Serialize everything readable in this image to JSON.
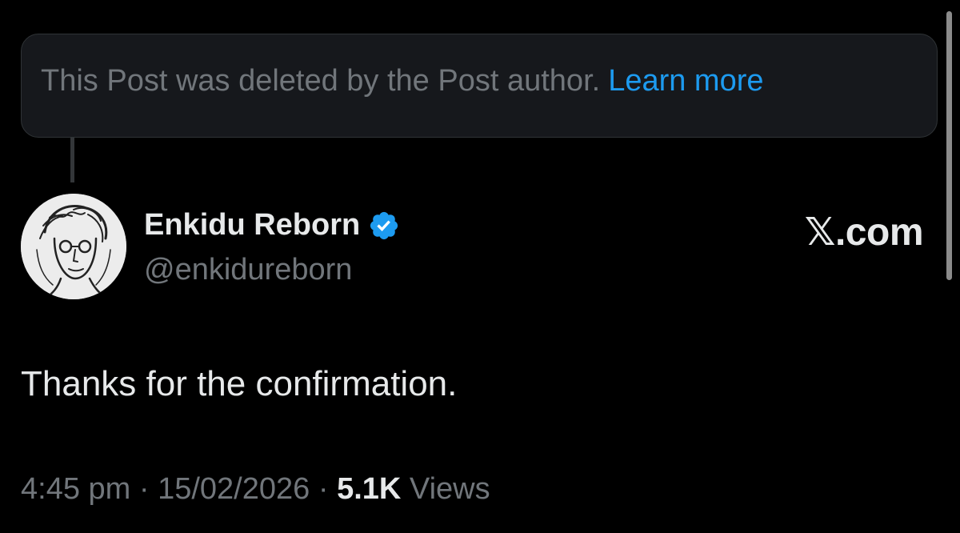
{
  "deleted_notice": {
    "text": "This Post was deleted by the Post author.",
    "link_label": "Learn more"
  },
  "author": {
    "display_name": "Enkidu Reborn",
    "handle": "@enkidureborn",
    "verified_icon": "verified-badge-icon",
    "avatar_icon": "sketched-portrait-avatar"
  },
  "brand": {
    "label": "𝕏.com"
  },
  "post": {
    "text": "Thanks for the confirmation."
  },
  "meta": {
    "time": "4:45 pm",
    "separator": "·",
    "date": "15/02/2026",
    "views_count": "5.1K",
    "views_label": "Views"
  },
  "colors": {
    "background": "#000000",
    "card_background": "#16181c",
    "primary_text": "#e7e9ea",
    "secondary_text": "#71767b",
    "link": "#1d9bf0"
  }
}
